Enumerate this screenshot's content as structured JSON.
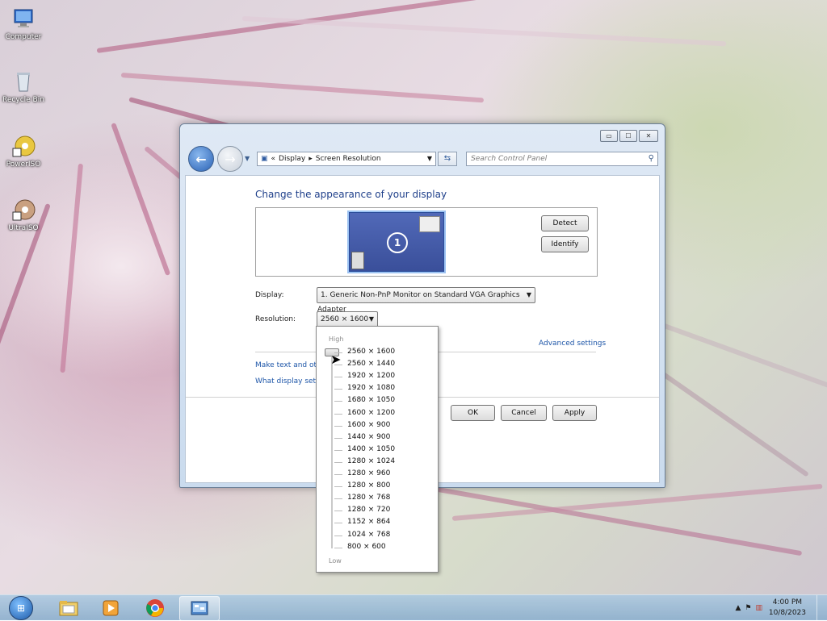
{
  "desktop": {
    "icons": [
      {
        "label": "Computer",
        "icon": "computer-icon"
      },
      {
        "label": "Recycle Bin",
        "icon": "recycle-bin-icon"
      },
      {
        "label": "PowerISO",
        "icon": "poweriso-icon"
      },
      {
        "label": "UltraISO",
        "icon": "ultraiso-icon"
      }
    ]
  },
  "window": {
    "controls": {
      "minimize": "▭",
      "maximize": "☐",
      "close": "✕"
    },
    "breadcrumb": {
      "sep1": "«",
      "item1": "Display",
      "sep2": "▸",
      "item2": "Screen Resolution"
    },
    "search_placeholder": "Search Control Panel",
    "title": "Change the appearance of your display",
    "monitor_number": "1",
    "detect_label": "Detect",
    "identify_label": "Identify",
    "display_label": "Display:",
    "display_value": "1. Generic Non-PnP Monitor on Standard VGA Graphics Adapter",
    "resolution_label": "Resolution:",
    "resolution_value": "2560 × 1600",
    "advanced_link": "Advanced settings",
    "link_text_size": "Make text and othe",
    "link_display_settings": "What display setting",
    "ok_label": "OK",
    "cancel_label": "Cancel",
    "apply_label": "Apply"
  },
  "resolution_popup": {
    "high_label": "High",
    "low_label": "Low",
    "options": [
      "2560 × 1600",
      "2560 × 1440",
      "1920 × 1200",
      "1920 × 1080",
      "1680 × 1050",
      "1600 × 1200",
      "1600 × 900",
      "1440 × 900",
      "1400 × 1050",
      "1280 × 1024",
      "1280 × 960",
      "1280 × 800",
      "1280 × 768",
      "1280 × 720",
      "1152 × 864",
      "1024 × 768",
      "800 × 600"
    ],
    "selected": "2560 × 1600"
  },
  "taskbar": {
    "items": [
      "windows-explorer-icon",
      "media-player-icon",
      "chrome-icon",
      "control-panel-icon"
    ],
    "active": "control-panel-icon",
    "clock_time": "4:00 PM",
    "clock_date": "10/8/2023"
  },
  "colors": {
    "accent": "#1e3f8a",
    "link": "#1e56a8",
    "taskbar": "#9fbcd6"
  }
}
